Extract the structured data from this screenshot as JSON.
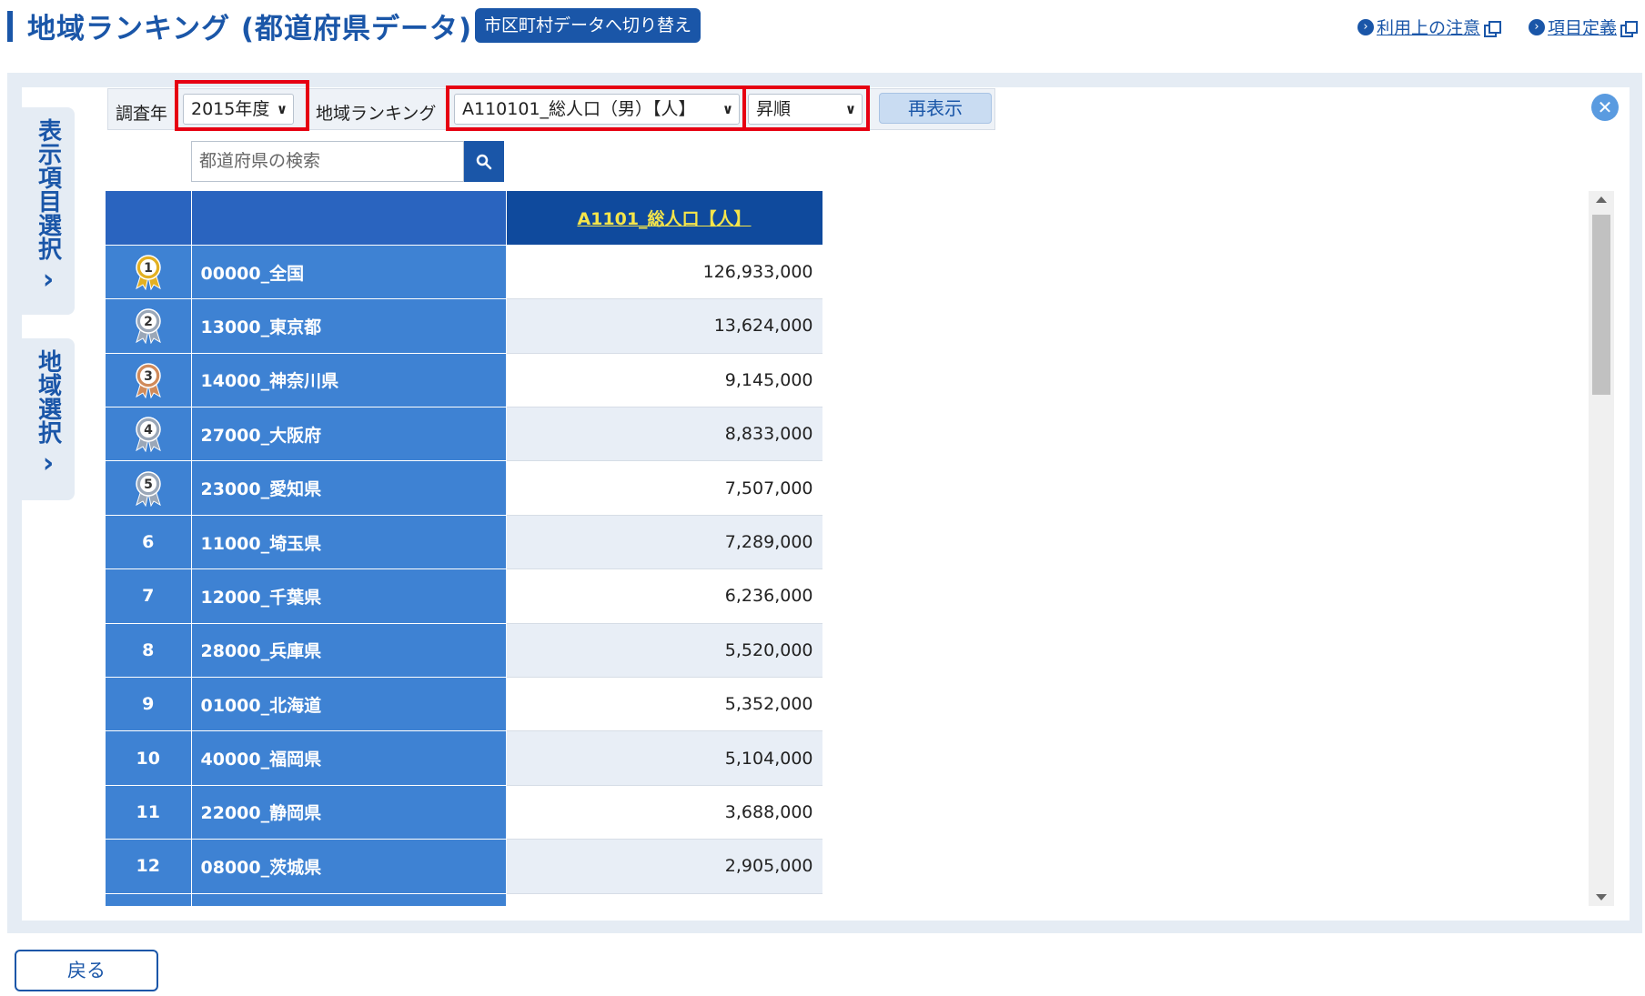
{
  "header": {
    "title": "地域ランキング (都道府県データ)",
    "switch_button": "市区町村データへ切り替え",
    "notes_link": "利用上の注意",
    "definition_link": "項目定義"
  },
  "sidebar": {
    "tab1_label": "表示項目選択",
    "tab2_label": "地域選択"
  },
  "controls": {
    "year_label": "調査年",
    "year_value": "2015年度",
    "ranking_label": "地域ランキング",
    "ranking_value": "A110101_総人口（男）【人】",
    "order_value": "昇順",
    "redisplay_button": "再表示"
  },
  "search": {
    "placeholder": "都道府県の検索"
  },
  "table": {
    "column_header": "A1101_総人口【人】",
    "rows": [
      {
        "rank": "1",
        "region": "00000_全国",
        "value": "126,933,000"
      },
      {
        "rank": "2",
        "region": "13000_東京都",
        "value": "13,624,000"
      },
      {
        "rank": "3",
        "region": "14000_神奈川県",
        "value": "9,145,000"
      },
      {
        "rank": "4",
        "region": "27000_大阪府",
        "value": "8,833,000"
      },
      {
        "rank": "5",
        "region": "23000_愛知県",
        "value": "7,507,000"
      },
      {
        "rank": "6",
        "region": "11000_埼玉県",
        "value": "7,289,000"
      },
      {
        "rank": "7",
        "region": "12000_千葉県",
        "value": "6,236,000"
      },
      {
        "rank": "8",
        "region": "28000_兵庫県",
        "value": "5,520,000"
      },
      {
        "rank": "9",
        "region": "01000_北海道",
        "value": "5,352,000"
      },
      {
        "rank": "10",
        "region": "40000_福岡県",
        "value": "5,104,000"
      },
      {
        "rank": "11",
        "region": "22000_静岡県",
        "value": "3,688,000"
      },
      {
        "rank": "12",
        "region": "08000_茨城県",
        "value": "2,905,000"
      }
    ]
  },
  "footer": {
    "back_button": "戻る"
  },
  "colors": {
    "brand_blue": "#1a56a8",
    "row_blue": "#3e82d3",
    "header_dark_blue": "#0f4a9d",
    "highlight_red": "#e60012",
    "gold": "#e2b022",
    "silver": "#9aa7b8",
    "bronze": "#d08a5a"
  },
  "icons": {
    "medal_1": "gold-medal-icon",
    "medal_2": "silver-medal-icon",
    "medal_3": "bronze-medal-icon",
    "medal_4": "medal-4-icon",
    "medal_5": "medal-5-icon"
  }
}
